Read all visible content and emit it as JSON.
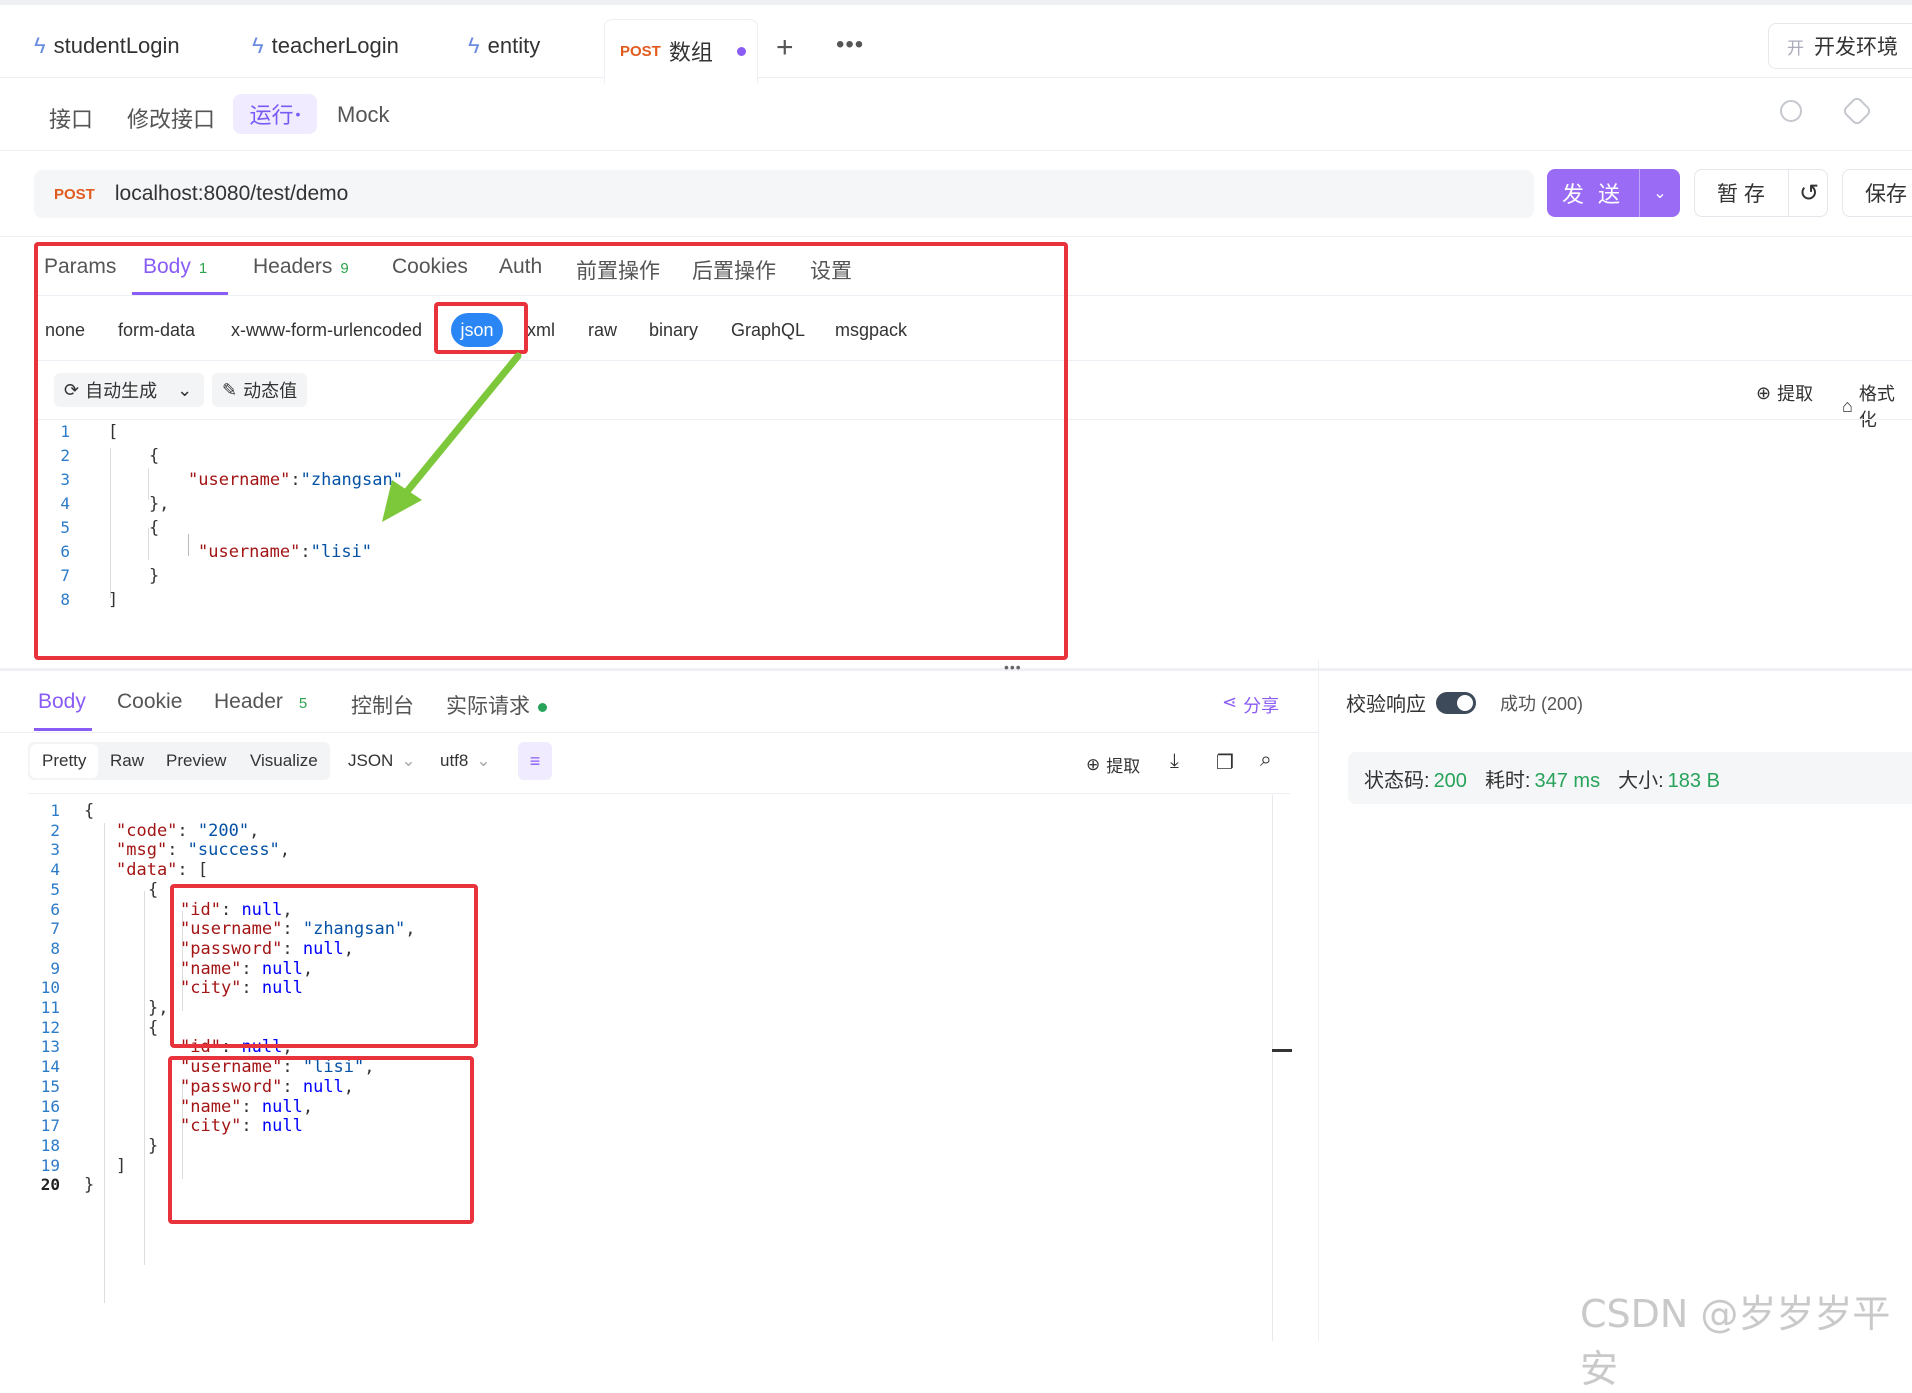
{
  "tabs": [
    {
      "label": "studentLogin"
    },
    {
      "label": "teacherLogin"
    },
    {
      "label": "entity"
    },
    {
      "method": "POST",
      "label": "数组"
    }
  ],
  "env": {
    "icon_char": "开",
    "label": "开发环境"
  },
  "subnav": {
    "items": [
      "接口",
      "修改接口",
      "运行",
      "Mock"
    ],
    "active_dot": "•"
  },
  "request": {
    "method": "POST",
    "url": "localhost:8080/test/demo"
  },
  "actions": {
    "send": "发 送",
    "save_temp": "暂 存",
    "save": "保存"
  },
  "req_tabs": [
    {
      "label": "Params"
    },
    {
      "label": "Body",
      "count": "1"
    },
    {
      "label": "Headers",
      "count": "9"
    },
    {
      "label": "Cookies"
    },
    {
      "label": "Auth"
    },
    {
      "label": "前置操作"
    },
    {
      "label": "后置操作"
    },
    {
      "label": "设置"
    }
  ],
  "body_types": [
    "none",
    "form-data",
    "x-www-form-urlencoded",
    "json",
    "xml",
    "raw",
    "binary",
    "GraphQL",
    "msgpack"
  ],
  "body_tools": {
    "auto": "自动生成",
    "dynamic": "动态值",
    "extract": "提取",
    "format": "格式化"
  },
  "request_body": [
    {
      "n": "1",
      "t": "["
    },
    {
      "n": "2",
      "t": "    {"
    },
    {
      "n": "3",
      "k": "\"username\"",
      "v": "\"zhangsan\""
    },
    {
      "n": "4",
      "t": "    },"
    },
    {
      "n": "5",
      "t": "    {"
    },
    {
      "n": "6",
      "k": "\"username\"",
      "v": "\"lisi\""
    },
    {
      "n": "7",
      "t": "    }"
    },
    {
      "n": "8",
      "t": "]"
    }
  ],
  "resp_tabs": [
    {
      "label": "Body"
    },
    {
      "label": "Cookie"
    },
    {
      "label": "Header",
      "count": "5"
    },
    {
      "label": "控制台"
    },
    {
      "label": "实际请求"
    }
  ],
  "share": "分享",
  "view_tabs": [
    "Pretty",
    "Raw",
    "Preview",
    "Visualize"
  ],
  "format_select": "JSON",
  "encoding_select": "utf8",
  "resp_tools": {
    "extract": "提取"
  },
  "validate": {
    "label": "校验响应",
    "result": "成功 (200)"
  },
  "status": {
    "code_label": "状态码:",
    "code": "200",
    "time_label": "耗时:",
    "time": "347 ms",
    "size_label": "大小:",
    "size": "183 B"
  },
  "response_body": [
    {
      "n": "1",
      "t": "{"
    },
    {
      "n": "2",
      "k": "\"code\"",
      "v": "\"200\"",
      "c": ","
    },
    {
      "n": "3",
      "k": "\"msg\"",
      "v": "\"success\"",
      "c": ","
    },
    {
      "n": "4",
      "k": "\"data\"",
      "t2": "["
    },
    {
      "n": "5",
      "t": "{"
    },
    {
      "n": "6",
      "k": "\"id\"",
      "kw": "null",
      "c": ","
    },
    {
      "n": "7",
      "k": "\"username\"",
      "v": "\"zhangsan\"",
      "c": ","
    },
    {
      "n": "8",
      "k": "\"password\"",
      "kw": "null",
      "c": ","
    },
    {
      "n": "9",
      "k": "\"name\"",
      "kw": "null",
      "c": ","
    },
    {
      "n": "10",
      "k": "\"city\"",
      "kw": "null"
    },
    {
      "n": "11",
      "t": "},"
    },
    {
      "n": "12",
      "t": "{"
    },
    {
      "n": "13",
      "k": "\"id\"",
      "kw": "null",
      "c": ","
    },
    {
      "n": "14",
      "k": "\"username\"",
      "v": "\"lisi\"",
      "c": ","
    },
    {
      "n": "15",
      "k": "\"password\"",
      "kw": "null",
      "c": ","
    },
    {
      "n": "16",
      "k": "\"name\"",
      "kw": "null",
      "c": ","
    },
    {
      "n": "17",
      "k": "\"city\"",
      "kw": "null"
    },
    {
      "n": "18",
      "t": "}"
    },
    {
      "n": "19",
      "t": "]"
    },
    {
      "n": "20",
      "t": "}"
    }
  ],
  "watermark": "CSDN @岁岁岁平安",
  "colors": {
    "accent": "#8a5cf6",
    "annotation_red": "#e8323c",
    "arrow_green": "#7cc73a",
    "json_blue": "#2b86f5"
  }
}
